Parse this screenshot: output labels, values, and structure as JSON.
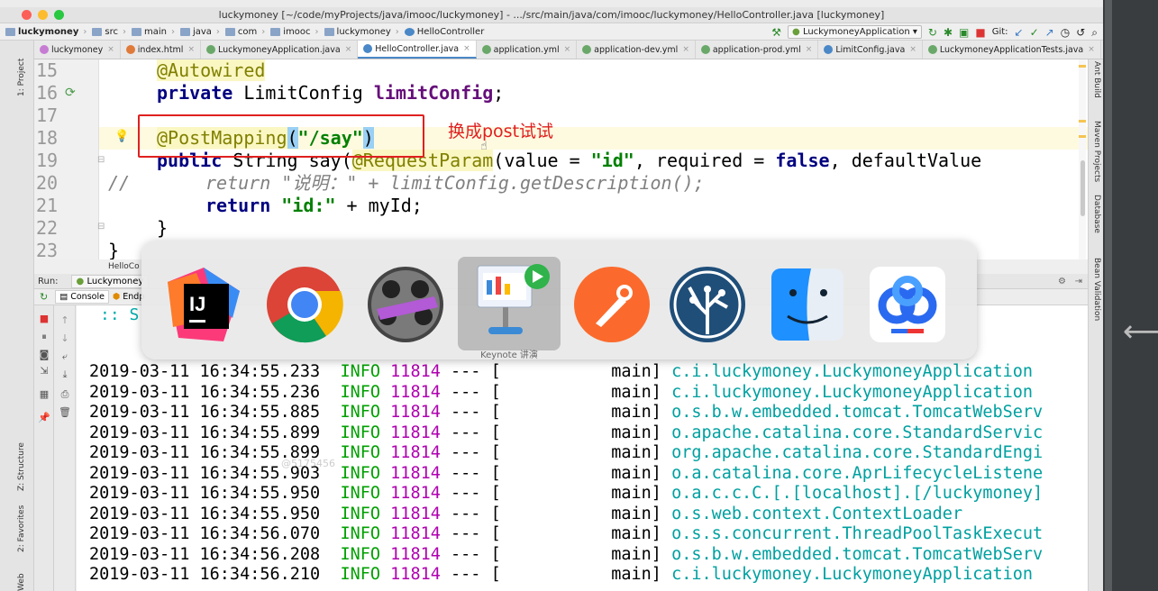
{
  "window": {
    "title": "luckymoney [~/code/myProjects/java/imooc/luckymoney] - .../src/main/java/com/imooc/luckymoney/HelloController.java [luckymoney]"
  },
  "breadcrumb": [
    "luckymoney",
    "src",
    "main",
    "java",
    "com",
    "imooc",
    "luckymoney",
    "HelloController"
  ],
  "toolbar": {
    "run_config": "LuckymoneyApplication",
    "git_label": "Git:"
  },
  "tabs": [
    {
      "label": "luckymoney",
      "color": "#c77cd4"
    },
    {
      "label": "index.html",
      "color": "#e07a3a"
    },
    {
      "label": "LuckymoneyApplication.java",
      "color": "#6aa86a"
    },
    {
      "label": "HelloController.java",
      "color": "#4a88c7",
      "active": true
    },
    {
      "label": "application.yml",
      "color": "#6aa86a"
    },
    {
      "label": "application-dev.yml",
      "color": "#6aa86a"
    },
    {
      "label": "application-prod.yml",
      "color": "#6aa86a"
    },
    {
      "label": "LimitConfig.java",
      "color": "#4a88c7"
    },
    {
      "label": "LuckymoneyApplicationTests.java",
      "color": "#6aa86a"
    }
  ],
  "sidebar_left": {
    "project": "1: Project",
    "structure": "Z: Structure",
    "favorites": "2: Favorites",
    "web": "Web"
  },
  "sidebar_right": {
    "ant": "Ant Build",
    "maven": "Maven Projects",
    "database": "Database",
    "bean": "Bean Validation"
  },
  "editor": {
    "line_numbers": [
      "15",
      "16",
      "17",
      "18",
      "19",
      "20",
      "21",
      "22",
      "23"
    ],
    "l15_ann": "@Autowired",
    "l16_kw": "private",
    "l16_type": " LimitConfig ",
    "l16_field": "limitConfig",
    "l16_end": ";",
    "l18_ann": "@PostMapping",
    "l18_open": "(",
    "l18_str": "\"/say\"",
    "l18_close": ")",
    "l19_kw": "public",
    "l19_a": " String say(",
    "l19_ann": "@RequestParam",
    "l19_b": "(value = ",
    "l19_str": "\"id\"",
    "l19_c": ", required = ",
    "l19_kw2": "false",
    "l19_d": ", defaultValue",
    "l20_cmt": "//",
    "l20_ret": "return ",
    "l20_str": "\"说明：\"",
    "l20_rest": " + limitConfig.getDescription();",
    "l21_kw": "return",
    "l21_str": "\"id:\"",
    "l21_rest": " + myId;",
    "l22": "}",
    "l23": "}",
    "annotation_note": "换成post试试"
  },
  "run_panel": {
    "header": "HelloCo",
    "run_label": "Run:",
    "run_tab": "Luckymoney",
    "console_tab": "Console",
    "endpoints_tab": "Endp",
    "banner": ":: S"
  },
  "app_switcher": {
    "apps": [
      "intellij-idea",
      "chrome",
      "final-cut",
      "keynote",
      "postman",
      "sourcetree",
      "finder",
      "baidu-netdisk"
    ],
    "selected_label": "Keynote 讲演"
  },
  "watermark": "@5175456",
  "log": [
    {
      "ts": "2019-03-11 16:34:55.233",
      "lvl": "INFO",
      "pid": "11814",
      "sep": "---",
      "thread": "[           main]",
      "cls": "c.i.luckymoney.LuckymoneyApplication"
    },
    {
      "ts": "2019-03-11 16:34:55.236",
      "lvl": "INFO",
      "pid": "11814",
      "sep": "---",
      "thread": "[           main]",
      "cls": "c.i.luckymoney.LuckymoneyApplication"
    },
    {
      "ts": "2019-03-11 16:34:55.885",
      "lvl": "INFO",
      "pid": "11814",
      "sep": "---",
      "thread": "[           main]",
      "cls": "o.s.b.w.embedded.tomcat.TomcatWebServ"
    },
    {
      "ts": "2019-03-11 16:34:55.899",
      "lvl": "INFO",
      "pid": "11814",
      "sep": "---",
      "thread": "[           main]",
      "cls": "o.apache.catalina.core.StandardServic"
    },
    {
      "ts": "2019-03-11 16:34:55.899",
      "lvl": "INFO",
      "pid": "11814",
      "sep": "---",
      "thread": "[           main]",
      "cls": "org.apache.catalina.core.StandardEngi"
    },
    {
      "ts": "2019-03-11 16:34:55.903",
      "lvl": "INFO",
      "pid": "11814",
      "sep": "---",
      "thread": "[           main]",
      "cls": "o.a.catalina.core.AprLifecycleListene"
    },
    {
      "ts": "2019-03-11 16:34:55.950",
      "lvl": "INFO",
      "pid": "11814",
      "sep": "---",
      "thread": "[           main]",
      "cls": "o.a.c.c.C.[.[localhost].[/luckymoney]"
    },
    {
      "ts": "2019-03-11 16:34:55.950",
      "lvl": "INFO",
      "pid": "11814",
      "sep": "---",
      "thread": "[           main]",
      "cls": "o.s.web.context.ContextLoader"
    },
    {
      "ts": "2019-03-11 16:34:56.070",
      "lvl": "INFO",
      "pid": "11814",
      "sep": "---",
      "thread": "[           main]",
      "cls": "o.s.s.concurrent.ThreadPoolTaskExecut"
    },
    {
      "ts": "2019-03-11 16:34:56.208",
      "lvl": "INFO",
      "pid": "11814",
      "sep": "---",
      "thread": "[           main]",
      "cls": "o.s.b.w.embedded.tomcat.TomcatWebServ"
    },
    {
      "ts": "2019-03-11 16:34:56.210",
      "lvl": "INFO",
      "pid": "11814",
      "sep": "---",
      "thread": "[           main]",
      "cls": "c.i.luckymoney.LuckymoneyApplication"
    }
  ]
}
